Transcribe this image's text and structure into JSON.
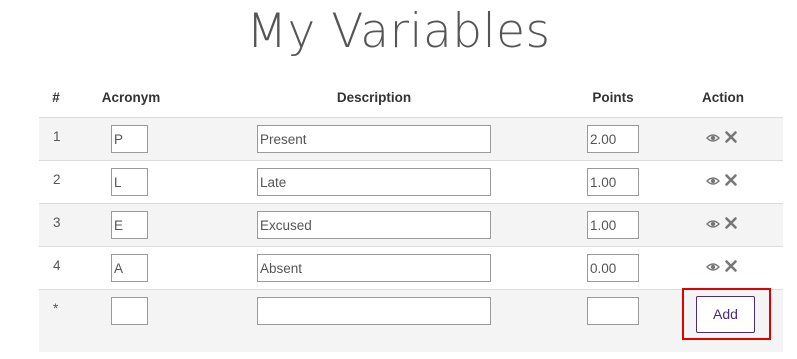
{
  "page": {
    "title": "My Variables"
  },
  "table": {
    "headers": {
      "number": "#",
      "acronym": "Acronym",
      "description": "Description",
      "points": "Points",
      "action": "Action"
    },
    "rows": [
      {
        "number": "1",
        "acronym": "P",
        "description": "Present",
        "points": "2.00"
      },
      {
        "number": "2",
        "acronym": "L",
        "description": "Late",
        "points": "1.00"
      },
      {
        "number": "3",
        "acronym": "E",
        "description": "Excused",
        "points": "1.00"
      },
      {
        "number": "4",
        "acronym": "A",
        "description": "Absent",
        "points": "0.00"
      }
    ],
    "new_row": {
      "number": "*",
      "acronym": "",
      "description": "",
      "points": ""
    },
    "actions": {
      "view_icon": "eye-icon",
      "delete_icon": "close-icon"
    },
    "add_button_label": "Add"
  },
  "colors": {
    "accent": "#4b2c7a",
    "highlight": "#e00000",
    "stripe": "#f4f4f4"
  }
}
